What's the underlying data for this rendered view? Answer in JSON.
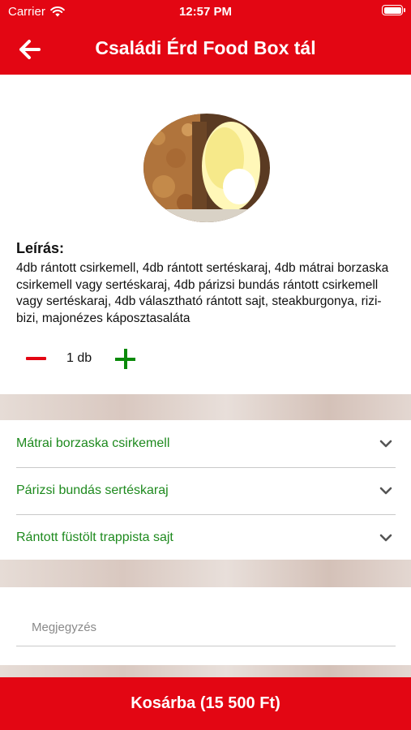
{
  "status_bar": {
    "carrier": "Carrier",
    "time": "12:57 PM",
    "battery_level": 1.0
  },
  "header": {
    "title": "Családi Érd Food Box tál",
    "back_icon": "arrow-left-icon"
  },
  "product": {
    "image_icon": "food-plate-image",
    "description_title": "Leírás:",
    "description": "4db rántott csirkemell, 4db rántott sertéskaraj, 4db mátrai borzaska csirkemell vagy sertéskaraj, 4db párizsi bundás rántott csirkemell vagy sertéskaraj, 4db választható rántott sajt, steakburgonya, rizi-bizi, majonézes káposztasaláta"
  },
  "quantity": {
    "value": "1 db",
    "minus_icon": "minus-icon",
    "plus_icon": "plus-icon"
  },
  "options": [
    {
      "label": "Mátrai borzaska csirkemell"
    },
    {
      "label": "Párizsi bundás sertéskaraj"
    },
    {
      "label": "Rántott füstölt trappista sajt"
    }
  ],
  "note": {
    "placeholder": "Megjegyzés"
  },
  "cart_button": {
    "label": "Kosárba (15 500 Ft)"
  },
  "colors": {
    "brand_red": "#e30613",
    "option_green": "#1e8a1e",
    "plus_green": "#0a8a0a"
  }
}
